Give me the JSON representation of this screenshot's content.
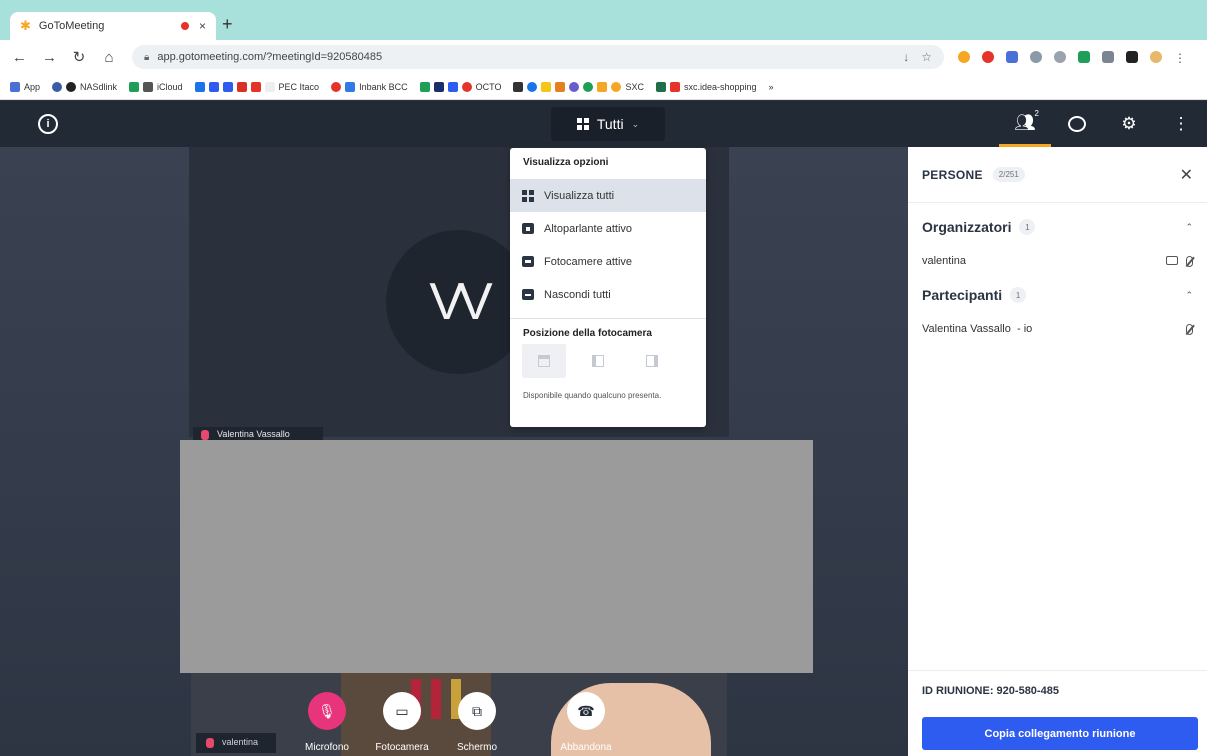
{
  "browser": {
    "tab_title": "GoToMeeting",
    "tab_close": "×",
    "new_tab": "+",
    "url": "app.gotomeeting.com/?meetingId=920580485",
    "bookmarks": [
      "App",
      "NASdlink",
      "iCloud",
      "PEC Itaco",
      "Inbank BCC",
      "OCTO",
      "SXC",
      "sxc.idea-shopping"
    ]
  },
  "topbar": {
    "view_label": "Tutti",
    "people_count": "2"
  },
  "view_menu": {
    "header": "Visualizza opzioni",
    "items": [
      {
        "label": "Visualizza tutti",
        "selected": true
      },
      {
        "label": "Altoparlante attivo",
        "selected": false
      },
      {
        "label": "Fotocamere attive",
        "selected": false
      },
      {
        "label": "Nascondi tutti",
        "selected": false
      }
    ],
    "camera_position_header": "Posizione della fotocamera",
    "note": "Disponibile quando qualcuno presenta."
  },
  "stage": {
    "avatar_initials": "VV",
    "tile_name": "Valentina Vassallo",
    "self_name": "valentina"
  },
  "controls": [
    {
      "label": "Microfono"
    },
    {
      "label": "Fotocamera"
    },
    {
      "label": "Schermo"
    },
    {
      "label": "Abbandona"
    }
  ],
  "panel": {
    "title": "PERSONE",
    "count": "2/251",
    "organizers_title": "Organizzatori",
    "organizers_count": "1",
    "organizers": [
      "valentina"
    ],
    "participants_title": "Partecipanti",
    "participants_count": "1",
    "participants": [
      "Valentina Vassallo  - io"
    ],
    "meeting_id": "ID RIUNIONE: 920-580-485",
    "copy_button": "Copia collegamento riunione"
  }
}
